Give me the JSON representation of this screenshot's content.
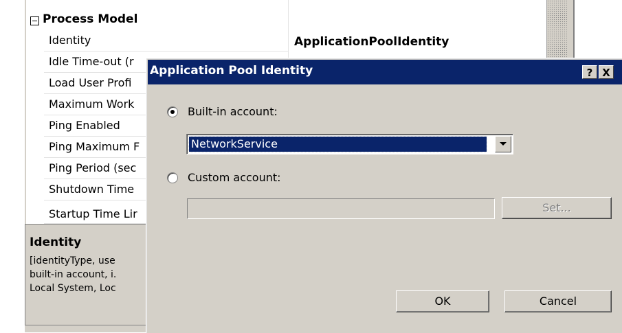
{
  "property_grid": {
    "category": "Process Model",
    "rows": [
      {
        "name": "Identity",
        "value": "ApplicationPoolIdentity"
      },
      {
        "name": "Idle Time-out (r",
        "value": ""
      },
      {
        "name": "Load User Profi",
        "value": ""
      },
      {
        "name": "Maximum Work",
        "value": ""
      },
      {
        "name": "Ping Enabled",
        "value": ""
      },
      {
        "name": "Ping Maximum F",
        "value": ""
      },
      {
        "name": "Ping Period (sec",
        "value": ""
      },
      {
        "name": "Shutdown Time",
        "value": ""
      },
      {
        "name": "Startup Time Lir",
        "value": ""
      }
    ],
    "description": {
      "title": "Identity",
      "lines": [
        "[identityType, use",
        "built-in account, i.",
        "Local System, Loc"
      ]
    }
  },
  "dialog": {
    "title": "Application Pool Identity",
    "help_label": "?",
    "close_label": "X",
    "builtin": {
      "label": "Built-in account:",
      "checked": true,
      "selected": "NetworkService"
    },
    "custom": {
      "label": "Custom account:",
      "checked": false,
      "value": ""
    },
    "set_label": "Set...",
    "ok_label": "OK",
    "cancel_label": "Cancel"
  }
}
